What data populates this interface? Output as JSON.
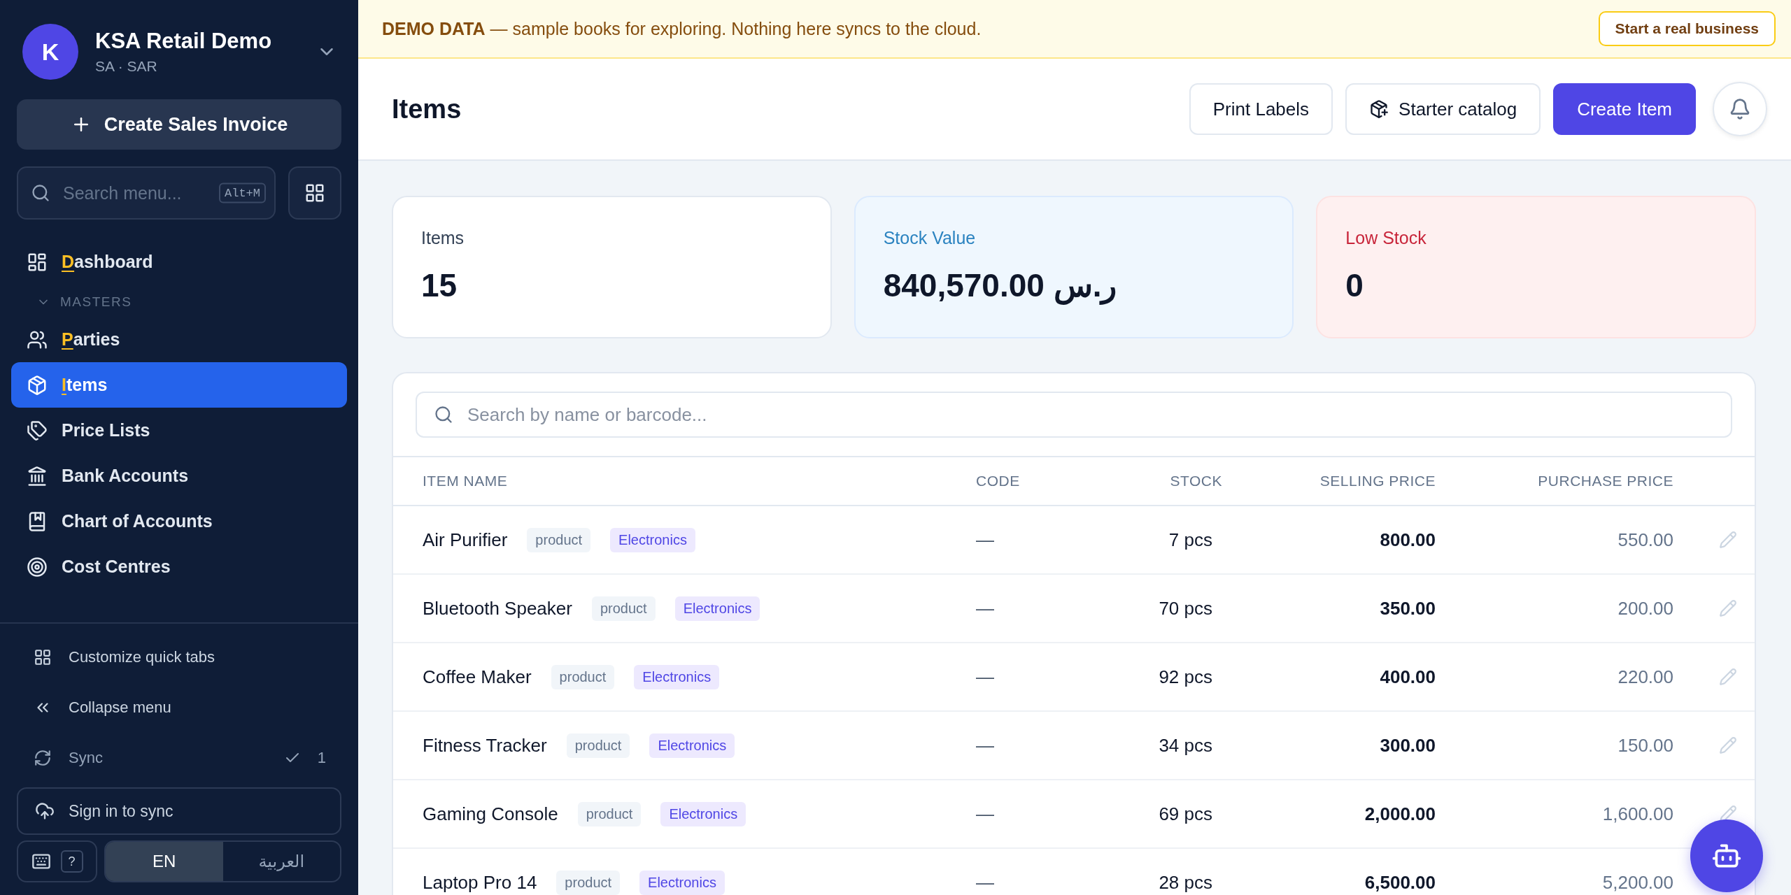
{
  "sidebar": {
    "org": {
      "initial": "K",
      "name": "KSA Retail Demo",
      "subtitle": "SA · SAR"
    },
    "primary_action": "Create Sales Invoice",
    "search": {
      "placeholder": "Search menu...",
      "shortcut": "Alt+M"
    },
    "nav": [
      {
        "label": "Dashboard",
        "mnemonic": true,
        "selected": false
      }
    ],
    "sections": [
      {
        "title": "MASTERS",
        "expanded": true,
        "items": [
          {
            "label": "Parties",
            "mnemonic": true,
            "selected": false
          },
          {
            "label": "Items",
            "mnemonic": true,
            "selected": true
          },
          {
            "label": "Price Lists",
            "mnemonic": false,
            "selected": false
          },
          {
            "label": "Bank Accounts",
            "mnemonic": false,
            "selected": false
          },
          {
            "label": "Chart of Accounts",
            "mnemonic": false,
            "selected": false
          },
          {
            "label": "Cost Centres",
            "mnemonic": false,
            "selected": false
          }
        ]
      }
    ],
    "footer_links": [
      "Customize quick tabs",
      "Collapse menu"
    ],
    "sync": {
      "label": "Sync",
      "count": "1"
    },
    "sign_in": "Sign in to sync",
    "help": "?",
    "languages": [
      {
        "label": "EN",
        "selected": true
      },
      {
        "label": "العربية",
        "selected": false
      }
    ]
  },
  "banner": {
    "title": "DEMO DATA",
    "text": "— sample books for exploring. Nothing here syncs to the cloud.",
    "action": "Start a real business"
  },
  "header": {
    "title": "Items",
    "buttons": [
      {
        "kind": "plain",
        "label": "Print Labels"
      },
      {
        "kind": "iconic",
        "label": "Starter catalog"
      },
      {
        "kind": "primary",
        "label": "Create Item"
      }
    ]
  },
  "stats": [
    {
      "color": "#334155",
      "label": "Items",
      "value": "15"
    },
    {
      "color": "#2b83c0",
      "label": "Stock Value",
      "value": "840,570.00 ر.س"
    },
    {
      "color": "#c8253a",
      "label": "Low Stock",
      "value": "0"
    }
  ],
  "table": {
    "search_placeholder": "Search by name or barcode...",
    "columns": [
      "ITEM NAME",
      "CODE",
      "STOCK",
      "SELLING PRICE",
      "PURCHASE PRICE"
    ],
    "rows": [
      {
        "name": "Air Purifier",
        "type": "product",
        "category": "Electronics",
        "code": "—",
        "stock": "7 pcs",
        "selling": "800.00",
        "purchase": "550.00"
      },
      {
        "name": "Bluetooth Speaker",
        "type": "product",
        "category": "Electronics",
        "code": "—",
        "stock": "70 pcs",
        "selling": "350.00",
        "purchase": "200.00"
      },
      {
        "name": "Coffee Maker",
        "type": "product",
        "category": "Electronics",
        "code": "—",
        "stock": "92 pcs",
        "selling": "400.00",
        "purchase": "220.00"
      },
      {
        "name": "Fitness Tracker",
        "type": "product",
        "category": "Electronics",
        "code": "—",
        "stock": "34 pcs",
        "selling": "300.00",
        "purchase": "150.00"
      },
      {
        "name": "Gaming Console",
        "type": "product",
        "category": "Electronics",
        "code": "—",
        "stock": "69 pcs",
        "selling": "2,000.00",
        "purchase": "1,600.00"
      },
      {
        "name": "Laptop Pro 14",
        "type": "product",
        "category": "Electronics",
        "code": "—",
        "stock": "28 pcs",
        "selling": "6,500.00",
        "purchase": "5,200.00"
      }
    ]
  }
}
